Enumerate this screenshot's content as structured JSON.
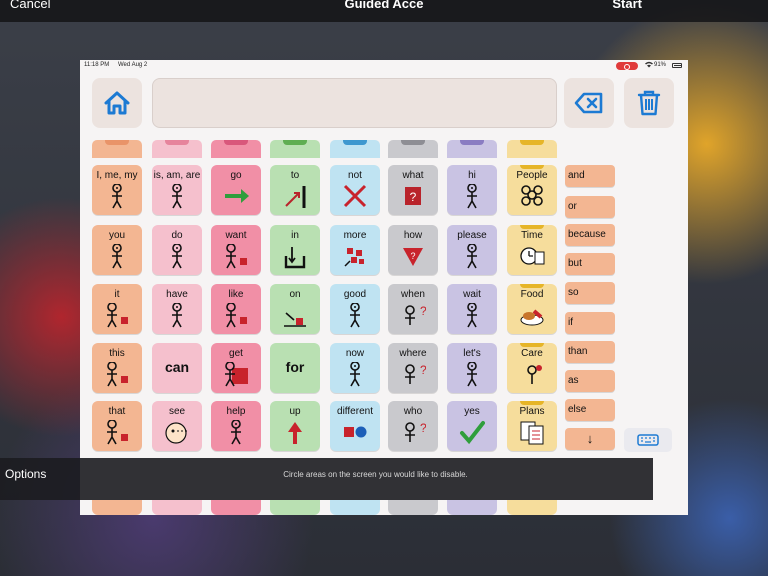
{
  "guided_access": {
    "cancel_label": "Cancel",
    "title": "Guided Acce",
    "start_label": "Start",
    "options_label": "Options",
    "hint": "Circle areas on the screen you would like to disable."
  },
  "status": {
    "time": "11:18 PM",
    "date": "Wed Aug 2",
    "battery": "91%"
  },
  "colors": {
    "pronoun": "#f3b692",
    "verb": "#f5c0cd",
    "action": "#f18fa6",
    "preposition": "#b9e0b2",
    "adjective": "#bfe3f2",
    "question": "#c9c9cd",
    "social": "#c9c3e3",
    "noun": "#f6dd9c",
    "conjunction": "#f3b692",
    "accent_blue": "#1c7ad3"
  },
  "columns": [
    {
      "color": "pronoun",
      "cap": "#e99469"
    },
    {
      "color": "verb",
      "cap": "#e6849c"
    },
    {
      "color": "action",
      "cap": "#d9577b"
    },
    {
      "color": "preposition",
      "cap": "#5fae52"
    },
    {
      "color": "adjective",
      "cap": "#3e98cf"
    },
    {
      "color": "question",
      "cap": "#8e8e94"
    },
    {
      "color": "social",
      "cap": "#8a7cc2"
    },
    {
      "color": "noun",
      "cap": "#e6b528"
    }
  ],
  "rows": [
    [
      "I, me, my",
      "is, am, are",
      "go",
      "to",
      "not",
      "what",
      "hi",
      "People"
    ],
    [
      "you",
      "do",
      "want",
      "in",
      "more",
      "how",
      "please",
      "Time"
    ],
    [
      "it",
      "have",
      "like",
      "on",
      "good",
      "when",
      "wait",
      "Food"
    ],
    [
      "this",
      "can",
      "get",
      "for",
      "now",
      "where",
      "let's",
      "Care"
    ],
    [
      "that",
      "see",
      "help",
      "up",
      "different",
      "who",
      "yes",
      "Plans"
    ]
  ],
  "words": [
    "and",
    "or",
    "because",
    "but",
    "so",
    "if",
    "than",
    "as",
    "else",
    "↓"
  ]
}
